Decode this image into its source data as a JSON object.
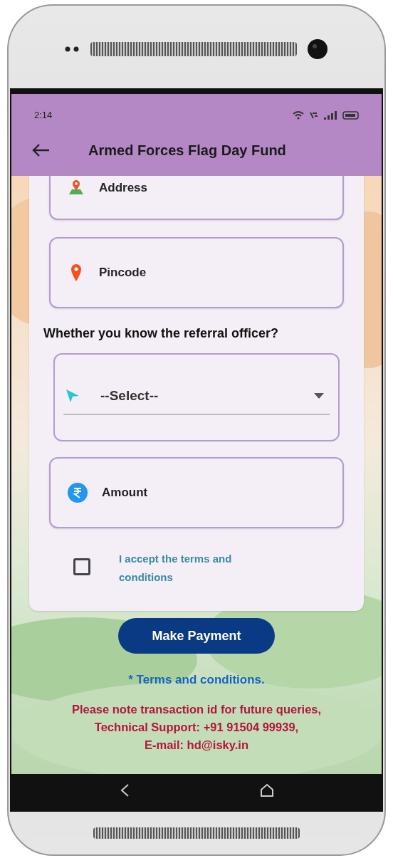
{
  "status_bar": {
    "time": "2:14"
  },
  "app_bar": {
    "title": "Armed Forces Flag Day Fund"
  },
  "form": {
    "items": [
      {
        "kind": "address",
        "label": "Address"
      },
      {
        "kind": "pincode",
        "label": "Pincode"
      },
      {
        "kind": "question",
        "label": "Whether you know the referral officer?"
      },
      {
        "kind": "dropdown",
        "placeholder": "--Select--"
      },
      {
        "kind": "amount",
        "label": "Amount"
      }
    ],
    "terms_checkbox": {
      "label": "I accept the terms and conditions",
      "checked": false
    }
  },
  "submit_button": "Make Payment",
  "terms_link": "* Terms and conditions.",
  "notice_lines": [
    "Please note transaction id for future queries,",
    "Technical Support: +91 91504 99939,",
    "E-mail: hd@isky.in"
  ]
}
